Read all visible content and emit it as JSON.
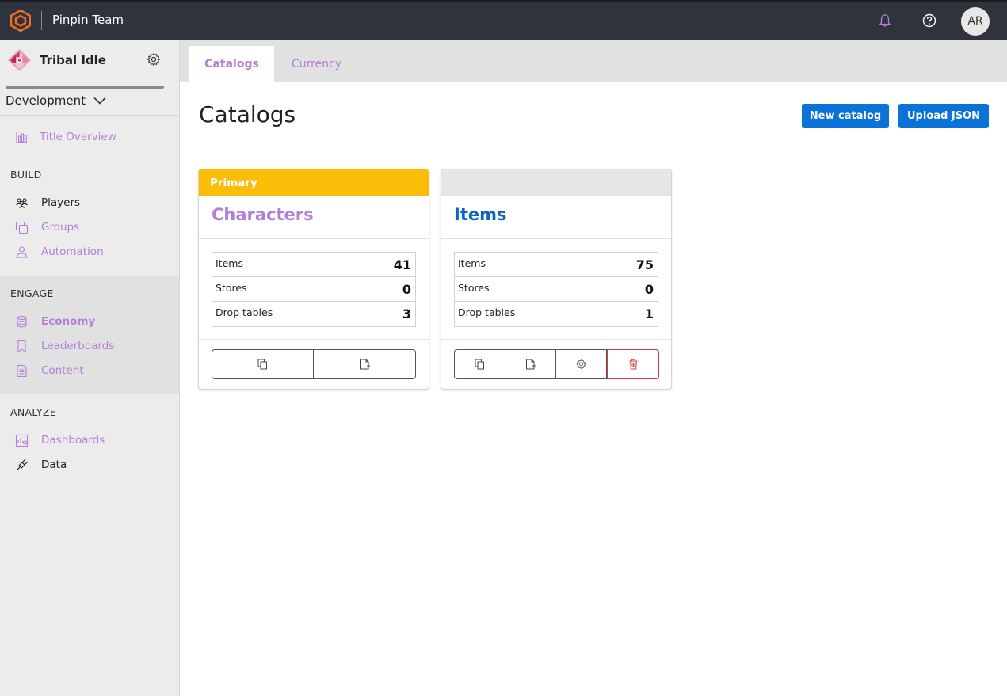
{
  "app": {
    "team_name": "Pinpin Team",
    "avatar_initials": "AR"
  },
  "sidebar": {
    "title_name": "Tribal Idle",
    "environment": "Development",
    "overview": "Title Overview",
    "sections": {
      "build": "BUILD",
      "engage": "ENGAGE",
      "analyze": "ANALYZE"
    },
    "items": {
      "players": "Players",
      "groups": "Groups",
      "automation": "Automation",
      "economy": "Economy",
      "leaderboards": "Leaderboards",
      "content": "Content",
      "dashboards": "Dashboards",
      "data": "Data"
    }
  },
  "tabs": {
    "catalogs": "Catalogs",
    "currency": "Currency"
  },
  "main": {
    "title": "Catalogs",
    "new_catalog_label": "New catalog",
    "upload_json_label": "Upload JSON"
  },
  "cards": [
    {
      "badge": "Primary",
      "name": "Characters",
      "stats": [
        {
          "label": "Items",
          "value": "41"
        },
        {
          "label": "Stores",
          "value": "0"
        },
        {
          "label": "Drop tables",
          "value": "3"
        }
      ]
    },
    {
      "badge": "",
      "name": "Items",
      "stats": [
        {
          "label": "Items",
          "value": "75"
        },
        {
          "label": "Stores",
          "value": "0"
        },
        {
          "label": "Drop tables",
          "value": "1"
        }
      ]
    }
  ],
  "colors": {
    "accent_purple": "#b57fd8",
    "primary_blue": "#0a72d8",
    "primary_badge": "#fbbd08",
    "topbar": "#2f333d",
    "delete_red": "#d23b3b"
  },
  "icons": {
    "logo": "playfab-hex-logo",
    "notifications": "bell-icon",
    "help": "question-icon",
    "settings": "gear-icon",
    "copy": "copy-icon",
    "export": "file-export-icon",
    "delete": "trash-icon"
  }
}
